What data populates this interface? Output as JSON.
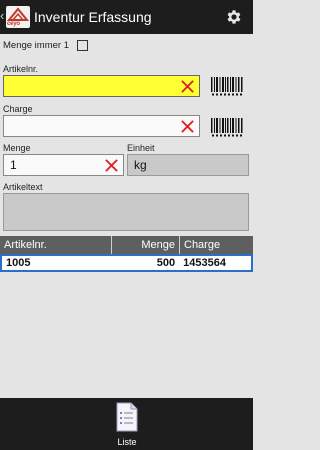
{
  "appbar": {
    "back_glyph": "‹",
    "logo_text": "ceyo",
    "title": "Inventur Erfassung",
    "settings_icon": "gear-icon"
  },
  "form": {
    "menge_immer_label": "Menge immer 1",
    "menge_immer_checked": false,
    "artikelnr_label": "Artikelnr.",
    "artikelnr_value": "",
    "charge_label": "Charge",
    "charge_value": "",
    "menge_label": "Menge",
    "menge_value": "1",
    "einheit_label": "Einheit",
    "einheit_value": "kg",
    "artikeltext_label": "Artikeltext",
    "artikeltext_value": ""
  },
  "table": {
    "columns": [
      "Artikelnr.",
      "Menge",
      "Charge"
    ],
    "rows": [
      [
        "1005",
        "500",
        "1453564"
      ]
    ]
  },
  "bottom": {
    "tab_label": "Liste",
    "tab_icon": "list-document-icon"
  },
  "colors": {
    "accent_yellow": "#ffff33",
    "clear_red": "#e02020",
    "selection_blue": "#2b70c8",
    "bar_dark": "#1d1d1d"
  }
}
